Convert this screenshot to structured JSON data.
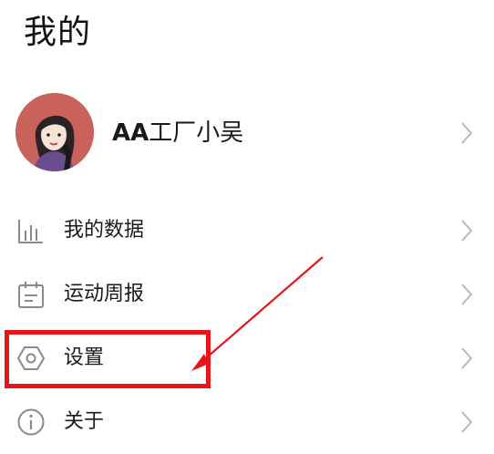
{
  "header": {
    "title": "我的"
  },
  "profile": {
    "name_prefix": "AA",
    "name_rest": "工厂小吴",
    "avatar_icon": "user-avatar"
  },
  "menu": {
    "items": [
      {
        "label": "我的数据",
        "icon": "bar-chart-icon"
      },
      {
        "label": "运动周报",
        "icon": "calendar-report-icon"
      },
      {
        "label": "设置",
        "icon": "settings-hexagon-icon"
      },
      {
        "label": "关于",
        "icon": "info-icon"
      }
    ]
  },
  "annotation": {
    "highlight_color": "#e5161b",
    "highlighted_item": "设置"
  },
  "colors": {
    "icon_gray": "#8a8a8a",
    "chevron_gray": "#b5b5b5",
    "avatar_bg": "#c8625b",
    "accent_red": "#e5161b"
  }
}
